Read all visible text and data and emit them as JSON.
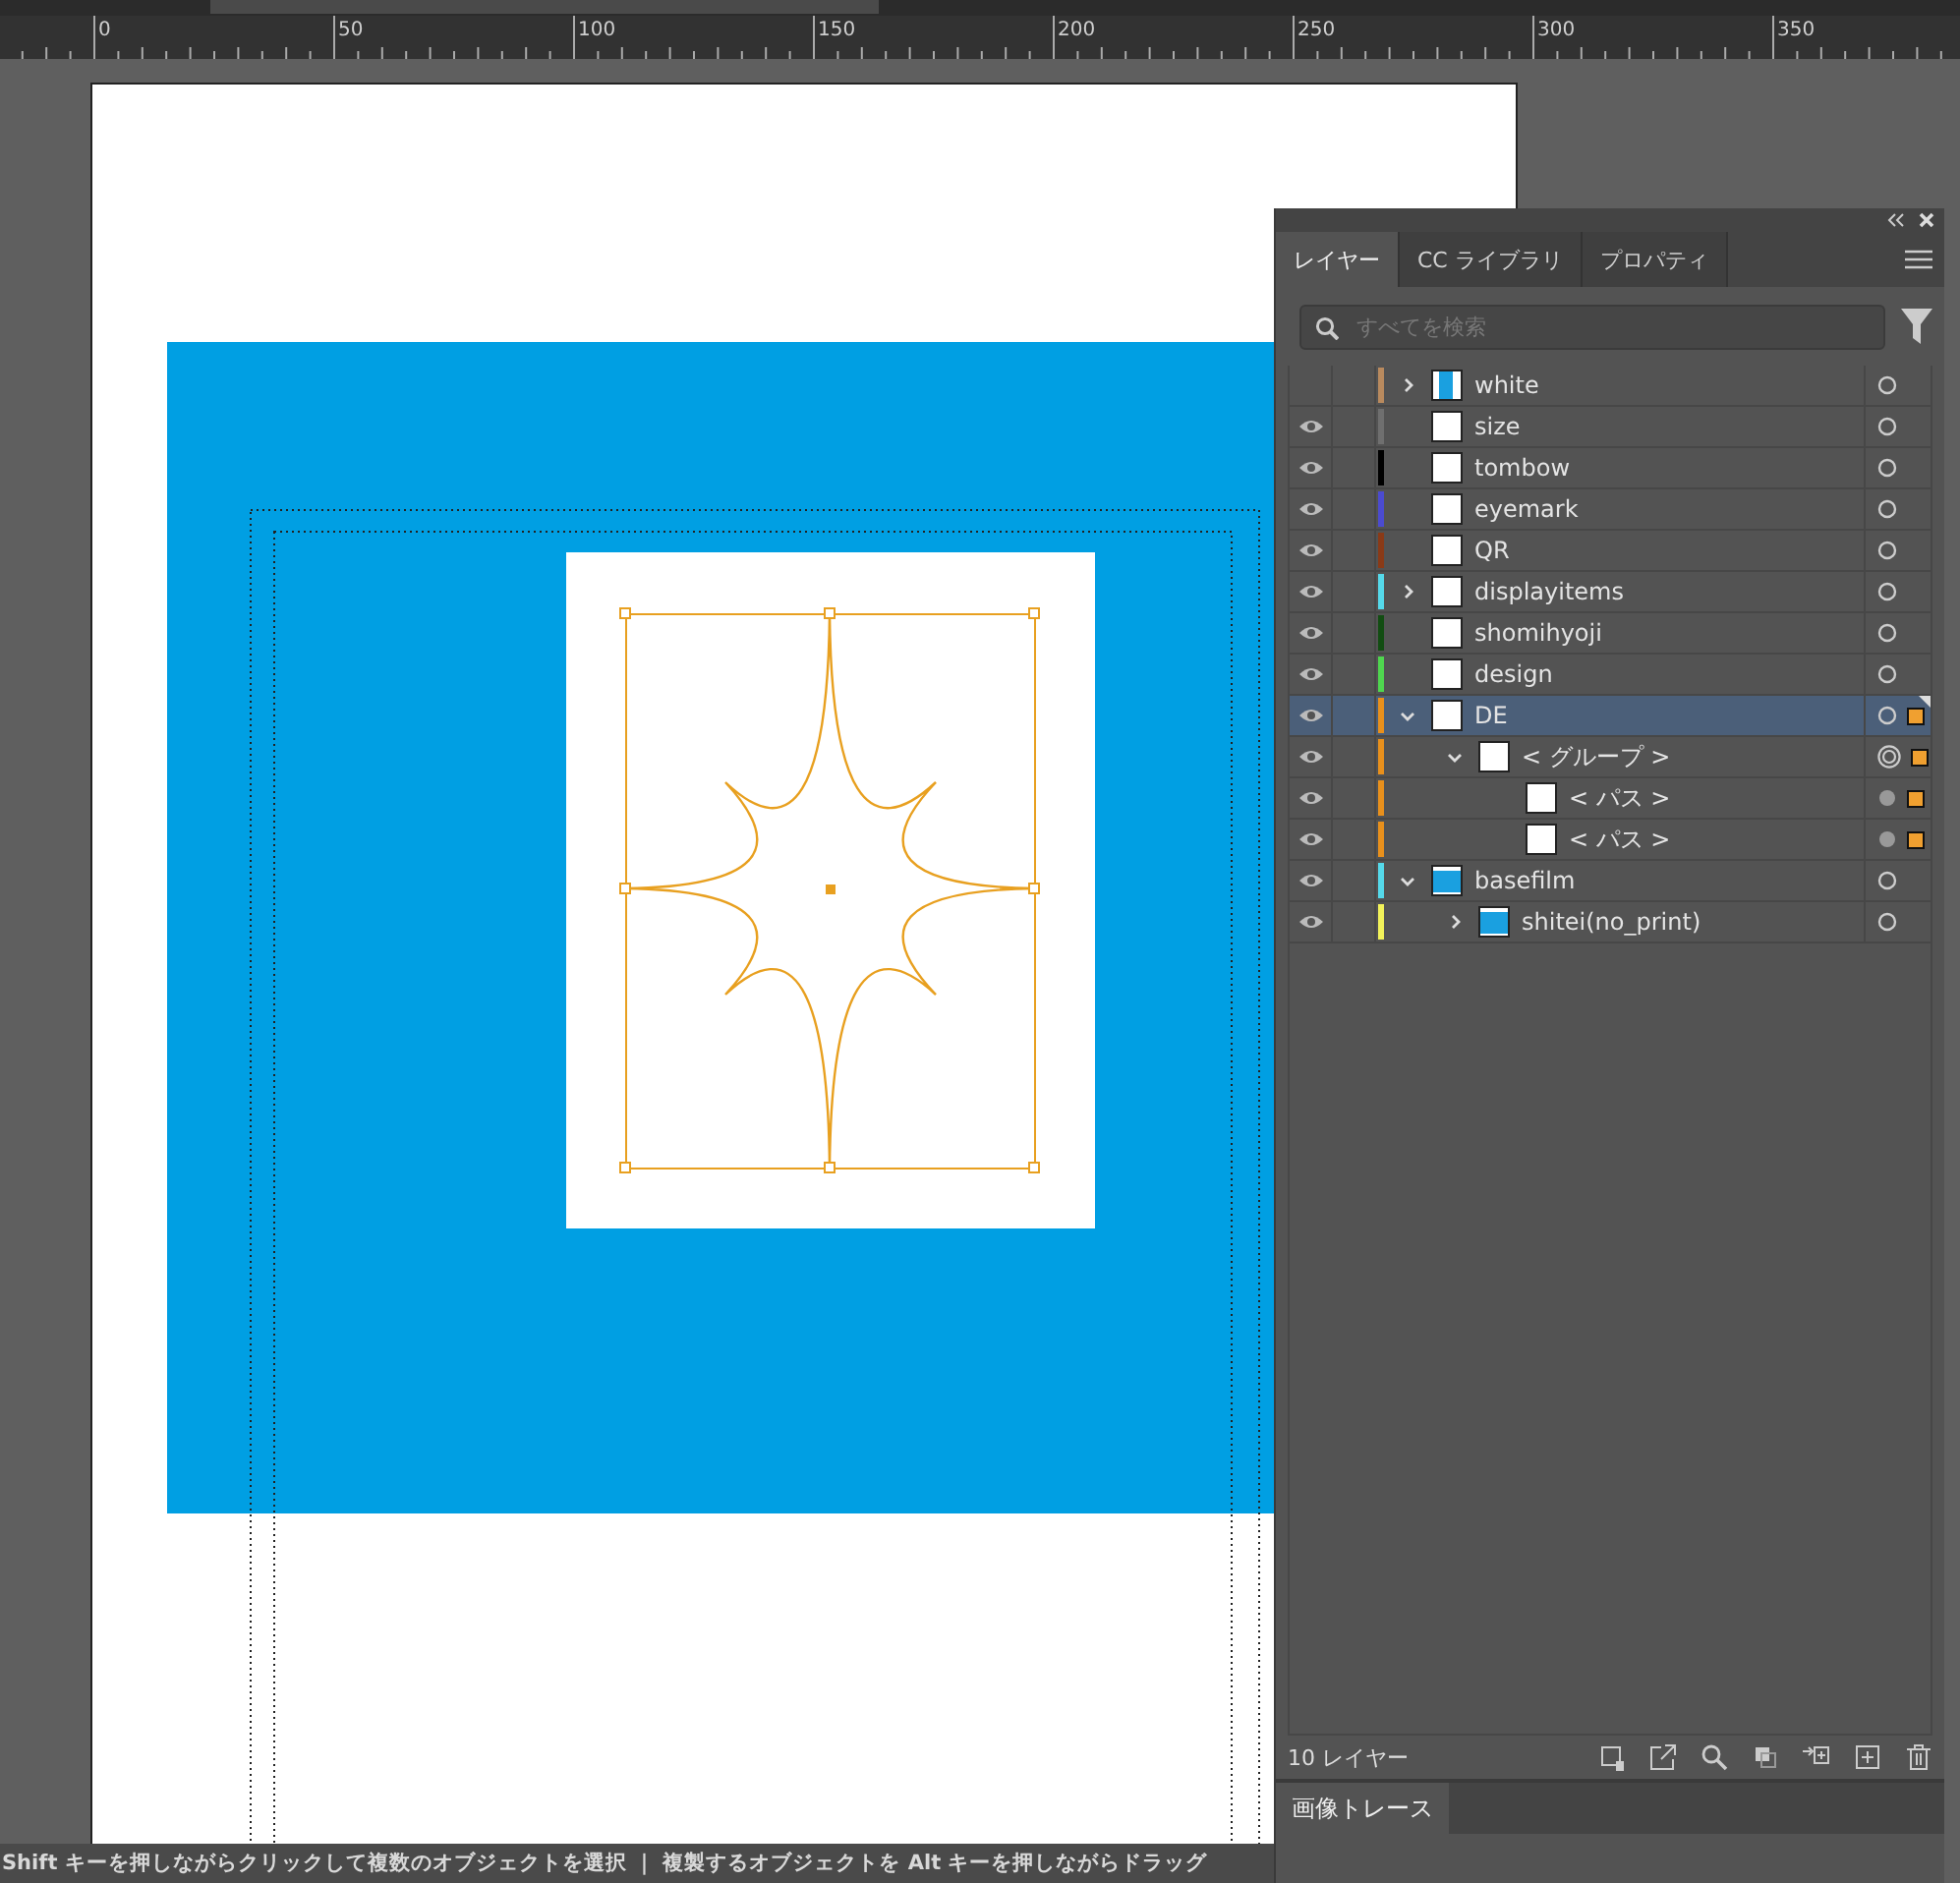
{
  "ruler": {
    "labels": [
      "0",
      "50",
      "100",
      "150",
      "200",
      "250",
      "300",
      "350"
    ]
  },
  "status_bar": {
    "text": "Shift キーを押しながらクリックして複数のオブジェクトを選択 ｜ 複製するオブジェクトを Alt キーを押しながらドラッグ"
  },
  "layers_panel": {
    "tabs": [
      {
        "label": "レイヤー",
        "selected": true
      },
      {
        "label": "CC ライブラリ",
        "selected": false
      },
      {
        "label": "プロパティ",
        "selected": false
      }
    ],
    "search": {
      "placeholder": "すべてを検索"
    },
    "layers": [
      {
        "name": "white",
        "color": "#b98a5e",
        "visible": false,
        "expanded": false,
        "selected": false,
        "thumbnail": {
          "kind": "mixed"
        },
        "target": {
          "kind": "circle"
        },
        "marked": false
      },
      {
        "name": "size",
        "color": "#6f6f6f",
        "visible": true,
        "selected": false,
        "thumbnail": {
          "kind": "blank"
        },
        "target": {
          "kind": "circle"
        },
        "marked": false
      },
      {
        "name": "tombow",
        "color": "#000000",
        "visible": true,
        "selected": false,
        "thumbnail": {
          "kind": "blank"
        },
        "target": {
          "kind": "circle"
        },
        "marked": false
      },
      {
        "name": "eyemark",
        "color": "#4b4bd0",
        "visible": true,
        "selected": false,
        "thumbnail": {
          "kind": "blank"
        },
        "target": {
          "kind": "circle"
        },
        "marked": false
      },
      {
        "name": "QR",
        "color": "#8a3a17",
        "visible": true,
        "selected": false,
        "thumbnail": {
          "kind": "blank"
        },
        "target": {
          "kind": "circle"
        },
        "marked": false
      },
      {
        "name": "displayitems",
        "color": "#55d9ea",
        "visible": true,
        "expanded": false,
        "selected": false,
        "thumbnail": {
          "kind": "blank"
        },
        "target": {
          "kind": "circle"
        },
        "marked": false
      },
      {
        "name": "shomihyoji",
        "color": "#124d12",
        "visible": true,
        "selected": false,
        "thumbnail": {
          "kind": "blank"
        },
        "target": {
          "kind": "circle"
        },
        "marked": false
      },
      {
        "name": "design",
        "color": "#4fd64f",
        "visible": true,
        "selected": false,
        "thumbnail": {
          "kind": "blank"
        },
        "target": {
          "kind": "circle"
        },
        "marked": false
      },
      {
        "name": "DE",
        "color": "#e8901c",
        "visible": true,
        "expanded": true,
        "selected": true,
        "thumbnail": {
          "kind": "blank"
        },
        "target": {
          "kind": "circle"
        },
        "marked": true,
        "children": [
          {
            "name": "< グループ >",
            "color": "#e8901c",
            "visible": true,
            "expanded": true,
            "selected": false,
            "thumbnail": {
              "kind": "blank"
            },
            "target": {
              "kind": "double"
            },
            "marked": true,
            "children": [
              {
                "name": "< パス >",
                "color": "#e8901c",
                "visible": true,
                "selected": false,
                "thumbnail": {
                  "kind": "blank"
                },
                "target": {
                  "kind": "filled"
                },
                "marked": true
              },
              {
                "name": "< パス >",
                "color": "#e8901c",
                "visible": true,
                "selected": false,
                "thumbnail": {
                  "kind": "blank"
                },
                "target": {
                  "kind": "filled"
                },
                "marked": true
              }
            ]
          }
        ]
      },
      {
        "name": "basefilm",
        "color": "#55d9ea",
        "visible": true,
        "expanded": true,
        "selected": false,
        "thumbnail": {
          "kind": "blue"
        },
        "target": {
          "kind": "circle"
        },
        "marked": false,
        "children": [
          {
            "name": "shitei(no_print)",
            "color": "#f2f25a",
            "visible": true,
            "expanded": false,
            "selected": false,
            "thumbnail": {
              "kind": "blue"
            },
            "target": {
              "kind": "circle"
            },
            "marked": false
          }
        ]
      }
    ],
    "footer": {
      "count": "10 レイヤー"
    }
  },
  "second_panel": {
    "tab": "画像トレース"
  }
}
